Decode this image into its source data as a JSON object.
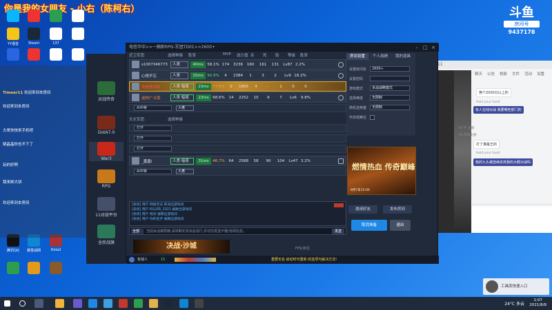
{
  "stream_title": "你是我的女朋友 - 小右（陈柯右）",
  "douyu": {
    "logo": "斗鱼",
    "room_label": "房间号",
    "room_number": "9437178"
  },
  "desktop_icons": [
    "YY语音",
    "Steam",
    "137",
    "",
    "",
    "",
    "",
    "",
    "",
    "",
    "",
    "",
    "",
    "",
    "",
    "",
    "",
    "",
    "腾讯QQ",
    "暴雪战网",
    "Dota2",
    "",
    "",
    "",
    "",
    "",
    ""
  ],
  "chat_lines": [
    {
      "user": "Timeer11",
      "text": "欢迎来到本房间"
    },
    {
      "user": "",
      "text": "欢迎来到本房间"
    },
    {
      "user": "",
      "text": "大哥你快来手机吧"
    },
    {
      "user": "",
      "text": "姚晶晶你也不下了"
    },
    {
      "user": "",
      "text": "玩的好啊"
    },
    {
      "user": "",
      "text": "我来刷大饼"
    },
    {
      "user": "",
      "text": "欢迎来到本房间"
    }
  ],
  "game_sidebar": [
    {
      "label": "对战传奇"
    },
    {
      "label": "DotA7.0"
    },
    {
      "label": "War3"
    },
    {
      "label": "RPG"
    },
    {
      "label": "11对战平台"
    },
    {
      "label": "全民战旗"
    }
  ],
  "lobby": {
    "title": "电信华中>>一触即RPG-军团TD01>>2600+",
    "team1_label": "近卫军团",
    "team2_label": "天灾军团",
    "col_headers": [
      "选择种族",
      "胜率",
      "MVP",
      "战力值",
      "杀",
      "死",
      "助",
      "等级",
      "胜率"
    ],
    "players": [
      {
        "name": "s1007346773",
        "race": "人类",
        "winrate": "40ms",
        "pct": "58.1%",
        "mvp": "174",
        "power": "3236",
        "k": "160",
        "d": "161",
        "a": "131",
        "lv": "Lv87",
        "wr2": "2.2%",
        "highlight": false
      },
      {
        "name": "心悦不忘",
        "race": "人类",
        "winrate": "15ms",
        "pct": "90.8%",
        "mvp": "4",
        "power": "2384",
        "k": "1",
        "d": "3",
        "a": "2",
        "lv": "Lv9",
        "wr2": "18.2%",
        "highlight": false
      },
      {
        "name": "我是陈柯右",
        "race": "人类 暗夜",
        "winrate": "23ms",
        "pct": "77.6%",
        "mvp": "0",
        "power": "1665",
        "k": "4",
        "d": "-",
        "a": "1",
        "lv": "0",
        "wr2": "0",
        "highlight": true
      },
      {
        "name": "迷你广义库",
        "race": "人类 暗夜",
        "winrate": "23ms",
        "pct": "68.6%",
        "mvp": "14",
        "power": "2252",
        "k": "10",
        "d": "6",
        "a": "7",
        "lv": "Lv6",
        "wr2": "9.8%",
        "highlight": false
      }
    ],
    "team1_subrow": {
      "dd": "AI中等",
      "race": "人类"
    },
    "team2_rows": [
      {
        "dd": "打开"
      },
      {
        "dd": "打开"
      },
      {
        "dd": "打开"
      }
    ],
    "team2_player": {
      "name": "_嘉嘉i",
      "race": "人类 暗夜",
      "winrate": "31ms",
      "pct": "46.7%",
      "mvp": "64",
      "power": "2588",
      "k": "58",
      "d": "90",
      "a": "104",
      "lv": "Lv47",
      "wr2": "3.2%"
    },
    "team2_subrow": {
      "dd": "AI中等",
      "race": "人类"
    },
    "settings_tabs": [
      "房间设置",
      "个人战绩",
      "我的道具"
    ],
    "settings": [
      {
        "label": "设置房间名",
        "value": "2600+"
      },
      {
        "label": "设置密码",
        "value": ""
      },
      {
        "label": "游戏模式",
        "value": "多战战略模式"
      },
      {
        "label": "选择难度",
        "value": "无限制"
      },
      {
        "label": "随机选英雄",
        "value": "无限制"
      },
      {
        "label": "开启观察位",
        "value": ""
      }
    ],
    "banner_title": "燃情热血 传奇巅峰",
    "banner_date": "8月7日15:00",
    "log_lines": [
      "[系统] 用户 网络无法 取消出游戏间",
      "[系统] 用户 KILLER_2021 被踢出游戏间",
      "[系统] 用户 情深 被踢出游戏间",
      "[系统] 用户 你的名字 被踢出游戏间"
    ],
    "input_placeholder": "当前会话被屏蔽,请将聊天发出后进行,并切勿发送不雅/违规信息。",
    "input_channel": "全部",
    "send_button": "发送",
    "invite_button": "邀请好友",
    "start_button": "取消准备",
    "exit_button": "退出",
    "ready_button": "发布房间",
    "announce": "重要无名·启动时可重新·的选项与解决方法!",
    "ad_text": "决战·沙城",
    "ping_label": "FPS/状况",
    "bottom_user": "有钱人",
    "bottom_count": "15"
  },
  "qq": {
    "title": "11",
    "tabs": [
      "聊天",
      "公告",
      "相册",
      "文件",
      "活动",
      "设置"
    ],
    "messages": [
      {
        "side": "l",
        "text": "换个2000分以上的"
      },
      {
        "side": "r",
        "text": "有人在线对战 我要哪些部门的"
      },
      {
        "side": "l",
        "text": "打了谁最王的"
      },
      {
        "side": "r",
        "text": "我的九头被连续杀死我的大概对战吗"
      }
    ],
    "names": [
      "KA 牛 主播",
      "KA 苹果主播"
    ],
    "hold_label": "Hold your hand"
  },
  "taskbar": {
    "weather": "24°C 多云",
    "time": "1:07",
    "date": "2021/8/8",
    "webcam_label": "工具库快速入口"
  }
}
